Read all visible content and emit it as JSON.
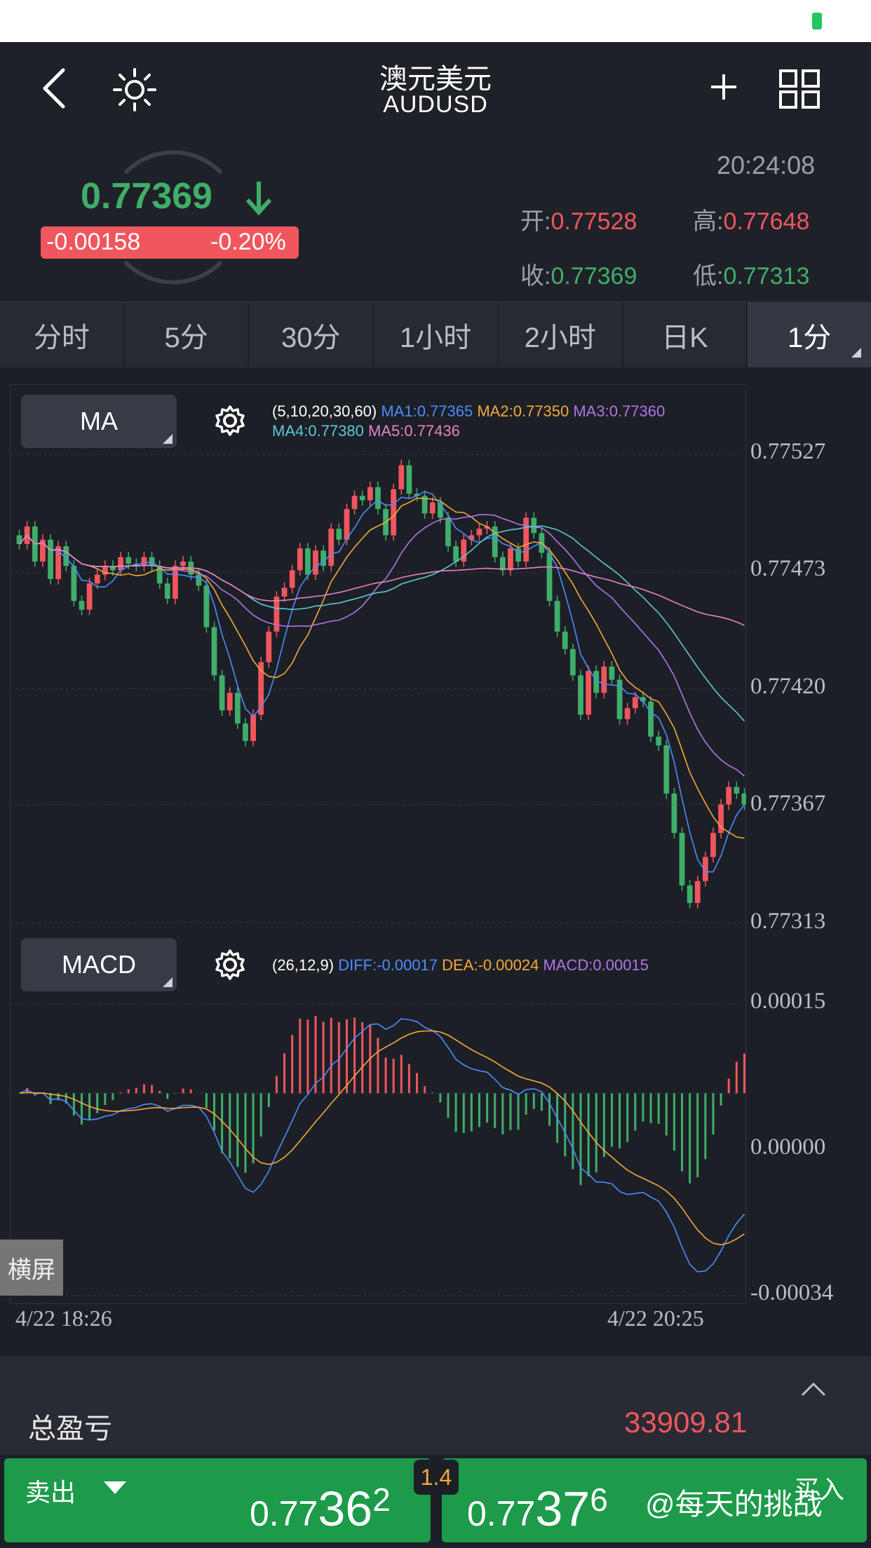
{
  "header": {
    "title_cn": "澳元美元",
    "title_en": "AUDUSD"
  },
  "quote": {
    "price": "0.77369",
    "change_abs": "-0.00158",
    "change_pct": "-0.20%",
    "time": "20:24:08",
    "open_label": "开:",
    "open": "0.77528",
    "high_label": "高:",
    "high": "0.77648",
    "close_label": "收:",
    "close": "0.77369",
    "low_label": "低:",
    "low": "0.77313",
    "colors": {
      "up": "#f0565e",
      "down": "#3fae6a"
    }
  },
  "tabs": [
    "分时",
    "5分",
    "30分",
    "1小时",
    "2小时",
    "日K",
    "1分"
  ],
  "active_tab": "1分",
  "ma_panel": {
    "button": "MA",
    "params": "(5,10,20,30,60)",
    "ma1": "MA1:0.77365",
    "ma2": "MA2:0.77350",
    "ma3": "MA3:0.77360",
    "ma4": "MA4:0.77380",
    "ma5": "MA5:0.77436",
    "y_ticks": [
      "0.77527",
      "0.77473",
      "0.77420",
      "0.77367",
      "0.77313"
    ]
  },
  "macd_panel": {
    "button": "MACD",
    "params": "(26,12,9)",
    "diff": "DIFF:-0.00017",
    "dea": "DEA:-0.00024",
    "macd": "MACD:0.00015",
    "y_ticks": [
      "0.00015",
      "0.00000",
      "-0.00034"
    ]
  },
  "x_axis": {
    "start": "4/22 18:26",
    "end": "4/22 20:25"
  },
  "landscape_button": "横屏",
  "pnl": {
    "label": "总盈亏",
    "value": "33909.81"
  },
  "trade": {
    "sell_label": "卖出",
    "buy_label": "买入",
    "spread": "1.4",
    "sell_price_small": "0.77",
    "sell_price_big": "36",
    "sell_price_sup": "2",
    "buy_price_small": "0.77",
    "buy_price_big": "37",
    "buy_price_sup": "6"
  },
  "watermark": "@每天的挑战",
  "chart_data": [
    {
      "type": "candlestick",
      "title": "",
      "ylim": [
        0.77313,
        0.77527
      ],
      "y_ticks": [
        0.77527,
        0.77473,
        0.7742,
        0.77367,
        0.77313
      ],
      "closes": [
        0.77486,
        0.77494,
        0.77478,
        0.77488,
        0.7747,
        0.77485,
        0.77476,
        0.7746,
        0.77456,
        0.77468,
        0.77472,
        0.77476,
        0.77474,
        0.7748,
        0.77477,
        0.77476,
        0.7748,
        0.77476,
        0.77468,
        0.77461,
        0.77476,
        0.77478,
        0.77472,
        0.77467,
        0.77448,
        0.77426,
        0.7741,
        0.77418,
        0.77404,
        0.77396,
        0.77408,
        0.77432,
        0.77446,
        0.77462,
        0.77466,
        0.77474,
        0.77484,
        0.77472,
        0.77483,
        0.77476,
        0.77493,
        0.77488,
        0.77502,
        0.77508,
        0.77506,
        0.77512,
        0.77502,
        0.7749,
        0.77511,
        0.77522,
        0.77509,
        0.77508,
        0.775,
        0.77505,
        0.77498,
        0.77485,
        0.77478,
        0.77488,
        0.7749,
        0.77493,
        0.77494,
        0.7748,
        0.77474,
        0.77484,
        0.77478,
        0.77498,
        0.77491,
        0.77482,
        0.7746,
        0.77446,
        0.77438,
        0.77426,
        0.77408,
        0.77428,
        0.77418,
        0.7743,
        0.77424,
        0.77406,
        0.77411,
        0.77416,
        0.77414,
        0.77398,
        0.77394,
        0.77372,
        0.77354,
        0.7733,
        0.77322,
        0.77332,
        0.77343,
        0.77354,
        0.77367,
        0.77375,
        0.77372,
        0.77367
      ],
      "series": [
        {
          "name": "MA1",
          "color": "#4c8cff"
        },
        {
          "name": "MA2",
          "color": "#f4a93a"
        },
        {
          "name": "MA3",
          "color": "#b076e8"
        },
        {
          "name": "MA4",
          "color": "#5fc7d6"
        },
        {
          "name": "MA5",
          "color": "#e783c5"
        }
      ]
    },
    {
      "type": "bar",
      "title": "",
      "ylim": [
        -0.00034,
        0.00015
      ],
      "y_ticks": [
        0.00015,
        0.0,
        -0.00034
      ],
      "series": [
        {
          "name": "DIFF",
          "color": "#4c8cff"
        },
        {
          "name": "DEA",
          "color": "#f4a93a"
        },
        {
          "name": "MACD",
          "color": "#b076e8"
        }
      ],
      "colors": {
        "positive": "#f0565e",
        "negative": "#3fae6a"
      }
    }
  ]
}
